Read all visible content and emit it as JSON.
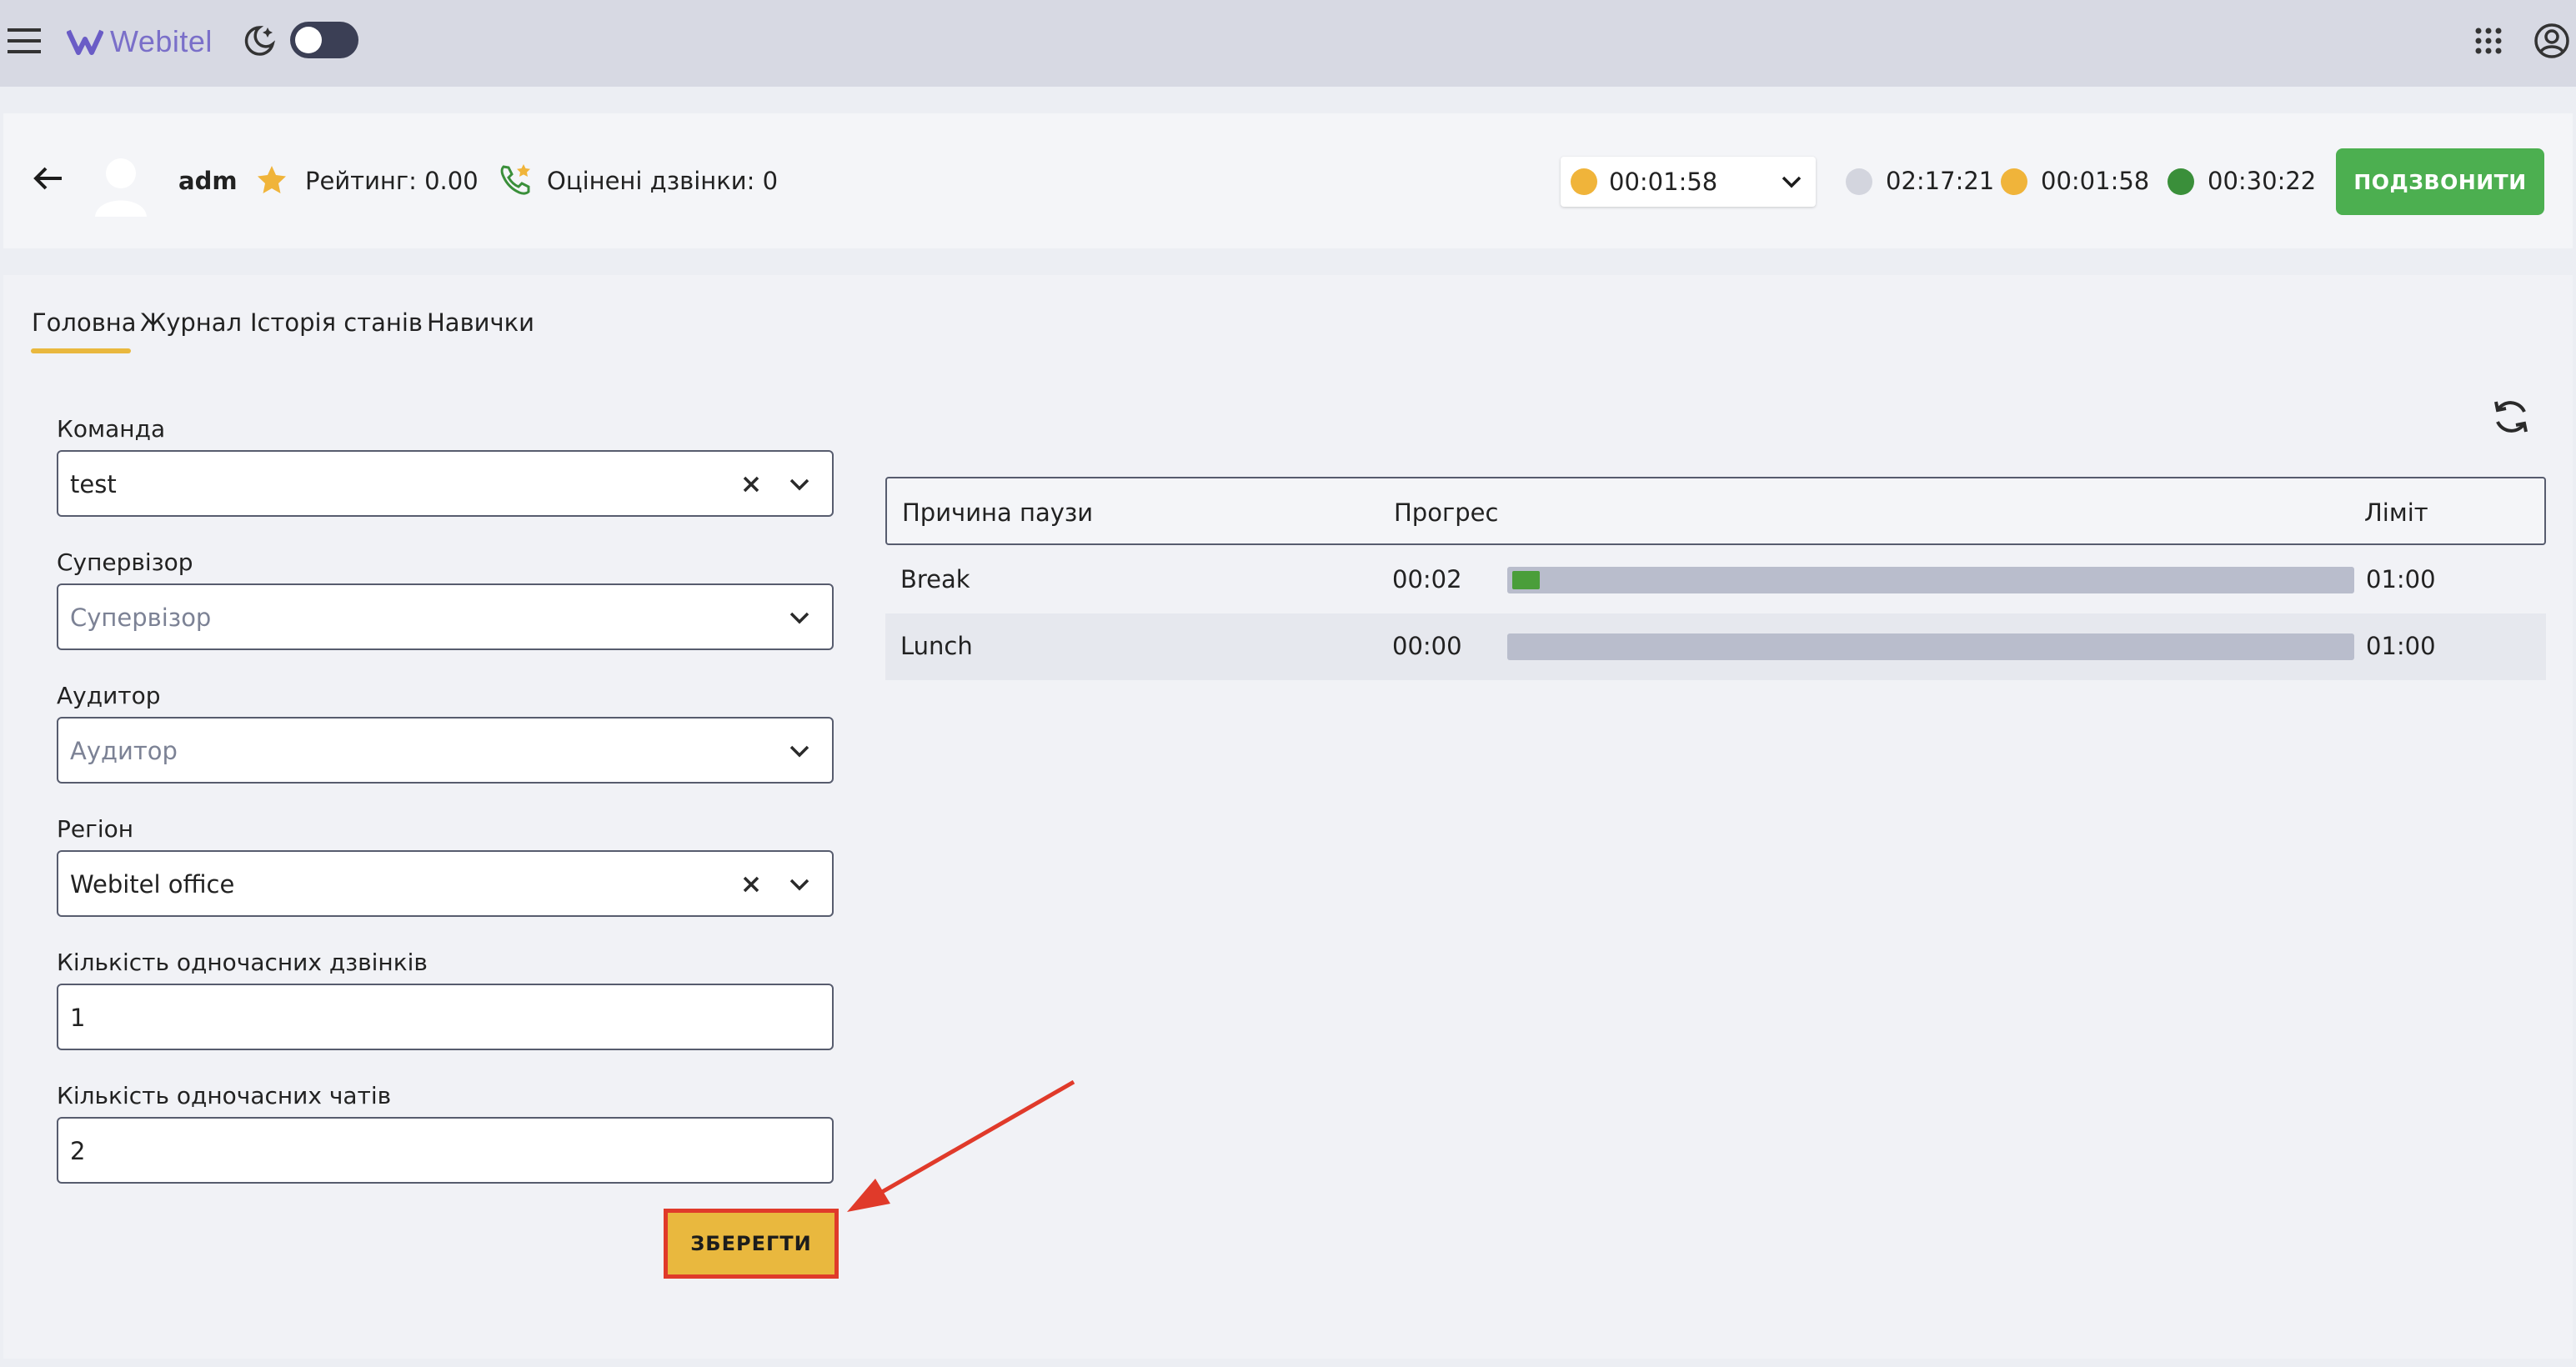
{
  "app": {
    "brand": "Webitel"
  },
  "agent": {
    "name": "adm",
    "rating_label": "Рейтинг: 0.00",
    "rated_calls_label": "Оцінені дзвінки: 0"
  },
  "status": {
    "current_timer": "00:01:58",
    "current_color": "#f0b43a",
    "timers": [
      {
        "value": "02:17:21",
        "color": "#d3d5de"
      },
      {
        "value": "00:01:58",
        "color": "#f0b43a"
      },
      {
        "value": "00:30:22",
        "color": "#3a8f3a"
      }
    ]
  },
  "actions": {
    "call_label": "ПОДЗВОНИТИ",
    "save_label": "ЗБЕРЕГТИ"
  },
  "tabs": [
    {
      "label": "Головна",
      "active": true
    },
    {
      "label": "Журнал",
      "active": false
    },
    {
      "label": "Історія станів",
      "active": false
    },
    {
      "label": "Навички",
      "active": false
    }
  ],
  "form": {
    "team": {
      "label": "Команда",
      "value": "test"
    },
    "supervisor": {
      "label": "Супервізор",
      "placeholder": "Супервізор"
    },
    "auditor": {
      "label": "Аудитор",
      "placeholder": "Аудитор"
    },
    "region": {
      "label": "Регіон",
      "value": "Webitel office"
    },
    "concurrent_calls": {
      "label": "Кількість одночасних дзвінків",
      "value": "1"
    },
    "concurrent_chats": {
      "label": "Кількість одночасних чатів",
      "value": "2"
    }
  },
  "pause_table": {
    "headers": {
      "reason": "Причина паузи",
      "progress": "Прогрес",
      "limit": "Ліміт"
    },
    "rows": [
      {
        "reason": "Break",
        "elapsed": "00:02",
        "limit": "01:00",
        "progress": 0.033
      },
      {
        "reason": "Lunch",
        "elapsed": "00:00",
        "limit": "01:00",
        "progress": 0
      }
    ]
  }
}
